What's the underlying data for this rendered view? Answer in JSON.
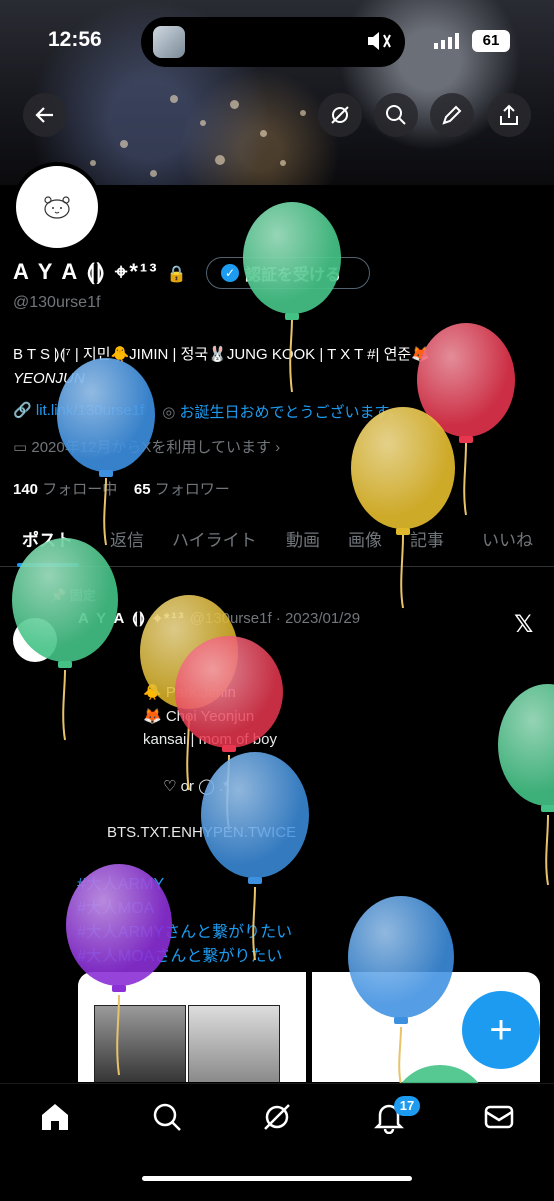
{
  "status": {
    "time": "12:56",
    "battery": "61"
  },
  "profile": {
    "display_name": "A Y A ⟬⟭ ⌖*¹³",
    "verify_button": "認証を受ける",
    "handle": "@130urse1f",
    "bio_line1": "B T S ⟭⟬⁷ | 지민🐥JIMIN | 정국🐰JUNG KOOK | T X T #| 연준🦊",
    "bio_line2": "YEONJUN",
    "link": "lit.link/130urse1f",
    "location": "お誕生日おめでとうございます。",
    "joined": "2020年12月からXを利用しています",
    "following_count": "140",
    "following_label": "フォロー中",
    "followers_count": "65",
    "followers_label": "フォロワー"
  },
  "tabs": [
    "ポスト",
    "返信",
    "ハイライト",
    "動画",
    "画像",
    "記事",
    "いいね"
  ],
  "tweet": {
    "pinned_label": "固定",
    "name": "A Y A ⟬⟭ ⌖*¹³",
    "meta": "@130urse1f · 2023/01/29",
    "lines": [
      "🐥 Park Jimin",
      "🦊 Choi Yeonjun",
      "kansai | mom of boy",
      "♡ or ◯ .*",
      "BTS.TXT.ENHYPEN.TWICE"
    ],
    "tags": [
      "#大人ARMY",
      "#大人MOA",
      "#大人ARMYさんと繋がりたい",
      "#大人MOAさんと繋がりたい"
    ]
  },
  "notifications_badge": "17",
  "colors": {
    "accent": "#1d9bf0",
    "background": "#000000"
  },
  "icons": [
    "back-icon",
    "grok-icon",
    "search-icon",
    "edit-icon",
    "share-icon",
    "home-icon",
    "explore-icon",
    "grok-icon",
    "bell-icon",
    "mail-icon"
  ]
}
